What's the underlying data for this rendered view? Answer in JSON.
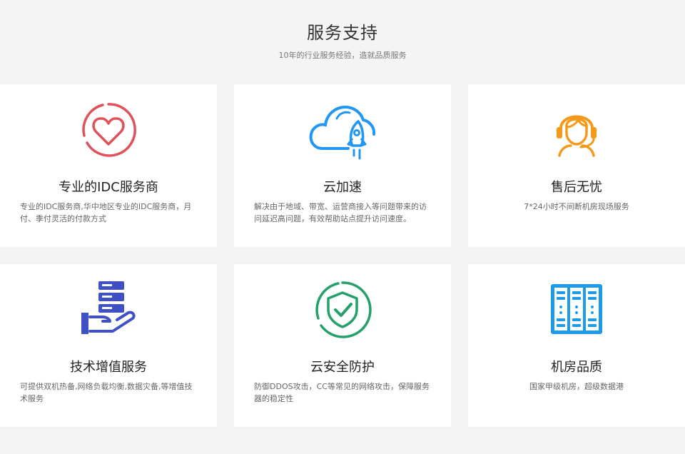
{
  "section": {
    "title": "服务支持",
    "subtitle": "10年的行业服务经验，造就品质服务"
  },
  "cards": [
    {
      "title": "专业的IDC服务商",
      "desc": "专业的IDC服务商,华中地区专业的IDC服务商，月付、季付灵活的付款方式",
      "icon": "heart-circle-icon",
      "color": "#e0525b"
    },
    {
      "title": "云加速",
      "desc": "解决由于地域、带宽、运营商接入等问题带来的访问延迟高问题，有效帮助站点提升访问速度。",
      "icon": "cloud-rocket-icon",
      "color": "#2196f3"
    },
    {
      "title": "售后无忧",
      "desc": "7*24小时不间断机房现场服务",
      "icon": "headset-support-icon",
      "color": "#f39a1c"
    },
    {
      "title": "技术增值服务",
      "desc": "可提供双机热备,网络负载均衡,数据灾备,等增值技术服务",
      "icon": "hand-server-icon",
      "color": "#3f51c4"
    },
    {
      "title": "云安全防护",
      "desc": "防御DDOS攻击，CC等常见的网络攻击，保障服务器的稳定性",
      "icon": "shield-check-icon",
      "color": "#26a06a"
    },
    {
      "title": "机房品质",
      "desc": "国家甲级机房，超级数据港",
      "icon": "server-rack-icon",
      "color": "#1e9be8"
    }
  ]
}
